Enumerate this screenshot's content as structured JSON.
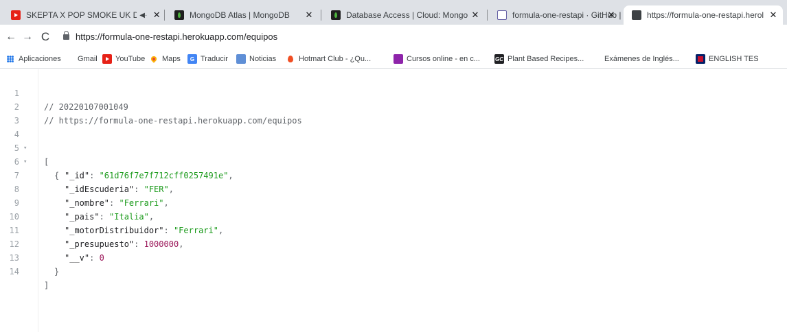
{
  "tabs": [
    {
      "title": "SKEPTA X POP SMOKE UK D",
      "icon": "youtube-icon",
      "audio": "◀·",
      "close": "✕"
    },
    {
      "title": "MongoDB Atlas | MongoDB",
      "icon": "mongodb-leaf-icon",
      "close": "✕"
    },
    {
      "title": "Database Access | Cloud: Mongo",
      "icon": "mongodb-leaf-icon",
      "close": "✕"
    },
    {
      "title": "formula-one-restapi · GitHub | He",
      "icon": "heroku-icon",
      "close": "✕"
    },
    {
      "title": "https://formula-one-restapi.herol",
      "icon": "globe-icon",
      "close": "✕",
      "active": true
    }
  ],
  "toolbar": {
    "back": "←",
    "forward": "→",
    "reload": "C",
    "url": "https://formula-one-restapi.herokuapp.com/equipos"
  },
  "bookmarks": [
    {
      "label": "Aplicaciones",
      "icon": "apps-grid-icon"
    },
    {
      "label": "Gmail",
      "icon": "gmail-icon",
      "glyph": "M"
    },
    {
      "label": "YouTube",
      "icon": "youtube-icon"
    },
    {
      "label": "Maps",
      "icon": "maps-pin-icon"
    },
    {
      "label": "Traducir",
      "icon": "translate-icon",
      "glyph": "G"
    },
    {
      "label": "Noticias",
      "icon": "news-icon"
    },
    {
      "label": "Hotmart Club - ¿Qu...",
      "icon": "hotmart-icon"
    },
    {
      "label": "Cursos online - en c...",
      "icon": "cursos-icon"
    },
    {
      "label": "Plant Based Recipes...",
      "icon": "gc-icon",
      "glyph": "GC"
    },
    {
      "label": "Exámenes de Inglés...",
      "icon": "examenes-icon",
      "glyph": "↗"
    },
    {
      "label": "ENGLISH TES",
      "icon": "uk-flag-icon"
    }
  ],
  "code": {
    "comment_date": "// 20220107001049",
    "comment_url": "// https://formula-one-restapi.herokuapp.com/equipos",
    "open_bracket": "[",
    "open_brace": "{",
    "close_brace": "}",
    "close_bracket": "]",
    "fold_marker": "▾",
    "fields": [
      {
        "key": "\"_id\"",
        "value": "\"61d76f7e7f712cff0257491e\"",
        "type": "string",
        "comma": ","
      },
      {
        "key": "\"_idEscuderia\"",
        "value": "\"FER\"",
        "type": "string",
        "comma": ","
      },
      {
        "key": "\"_nombre\"",
        "value": "\"Ferrari\"",
        "type": "string",
        "comma": ","
      },
      {
        "key": "\"_pais\"",
        "value": "\"Italia\"",
        "type": "string",
        "comma": ","
      },
      {
        "key": "\"_motorDistribuidor\"",
        "value": "\"Ferrari\"",
        "type": "string",
        "comma": ","
      },
      {
        "key": "\"_presupuesto\"",
        "value": "1000000",
        "type": "number",
        "comma": ","
      },
      {
        "key": "\"__v\"",
        "value": "0",
        "type": "number",
        "comma": ""
      }
    ],
    "line_numbers": [
      "1",
      "2",
      "3",
      "4",
      "5",
      "6",
      "7",
      "8",
      "9",
      "10",
      "11",
      "12",
      "13",
      "14"
    ]
  },
  "colors": {
    "string": "#1a9a1a",
    "number": "#9a1558",
    "youtube": "#e62117",
    "mongo_leaf": "#4db33d"
  }
}
